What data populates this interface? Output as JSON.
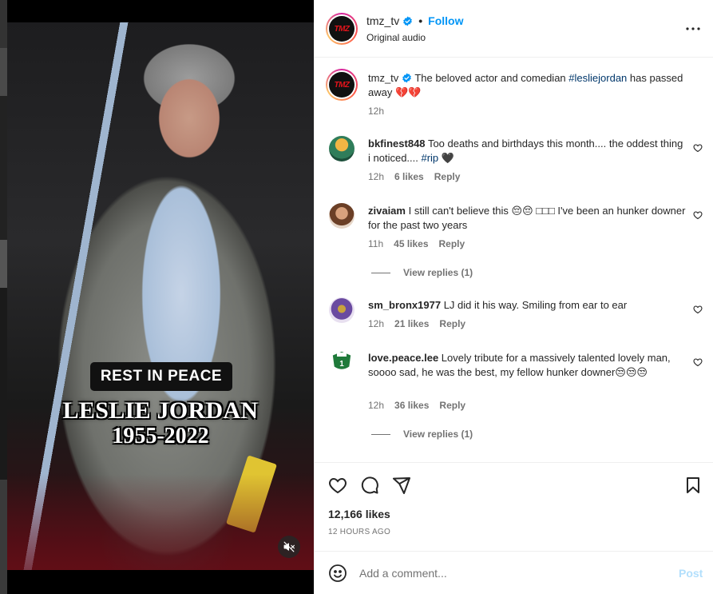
{
  "media": {
    "badge_text": "REST IN PEACE",
    "name_text": "LESLIE JORDAN",
    "years_text": "1955-2022",
    "mute_icon": "speaker-muted-icon"
  },
  "header": {
    "logo_text": "TMZ",
    "username": "tmz_tv",
    "separator": "•",
    "follow_label": "Follow",
    "audio_label": "Original audio",
    "more_icon": "more-horizontal-icon"
  },
  "caption": {
    "username": "tmz_tv",
    "text_before": "The beloved actor and comedian ",
    "hashtag": "#lesliejordan",
    "text_after": " has passed away 💔💔",
    "time": "12h"
  },
  "comments": [
    {
      "username": "bkfinest848",
      "text_before": "Too deaths and birthdays this month.... the oddest thing i noticed.... ",
      "hashtag": "#rip",
      "text_after": " 🖤",
      "time": "12h",
      "likes": "6 likes",
      "reply": "Reply",
      "avatar_color": "#3b7a3a"
    },
    {
      "username": "zivaiam",
      "text_before": "I still can't believe this 😔😔 □□□ I've been an hunker downer for the past two years",
      "hashtag": "",
      "text_after": "",
      "time": "11h",
      "likes": "45 likes",
      "reply": "Reply",
      "view_replies": "View replies (1)",
      "avatar_color": "#8a5a3c"
    },
    {
      "username": "sm_bronx1977",
      "text_before": "LJ did it his way. Smiling from ear to ear",
      "hashtag": "",
      "text_after": "",
      "time": "12h",
      "likes": "21 likes",
      "reply": "Reply",
      "avatar_color": "#7b5aa6"
    },
    {
      "username": "love.peace.lee",
      "text_before": "Lovely tribute for a massively talented lovely man, soooo sad, he was the best, my fellow hunker downer😒😒😒",
      "hashtag": "",
      "text_after": "",
      "time": "12h",
      "likes": "36 likes",
      "reply": "Reply",
      "view_replies": "View replies (1)",
      "avatar_color": "#1f7a3a"
    }
  ],
  "actions": {
    "like_icon": "heart-icon",
    "comment_icon": "comment-bubble-icon",
    "share_icon": "paper-plane-icon",
    "save_icon": "bookmark-icon",
    "likes_count": "12,166 likes",
    "time_ago": "12 HOURS AGO"
  },
  "add_comment": {
    "emoji_icon": "emoji-smile-icon",
    "placeholder": "Add a comment...",
    "post_label": "Post"
  },
  "colors": {
    "accent": "#0095f6",
    "hashtag": "#00376b",
    "muted": "#737373",
    "post_disabled": "#b2dffc"
  }
}
